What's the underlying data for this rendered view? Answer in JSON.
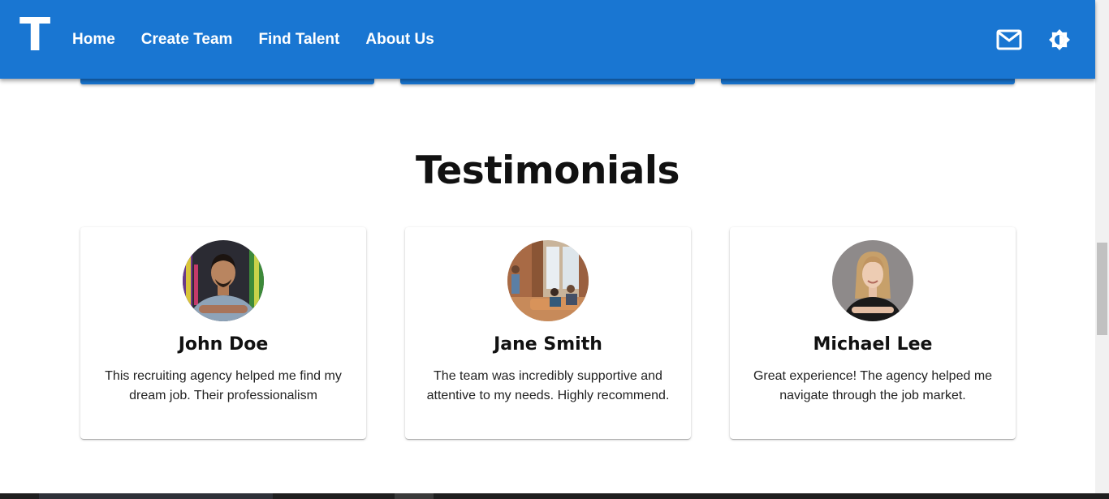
{
  "header": {
    "logo": "T",
    "nav": [
      "Home",
      "Create Team",
      "Find Talent",
      "About Us"
    ],
    "icons": [
      "mail-icon",
      "brightness-icon"
    ],
    "color": "#1976d2"
  },
  "testimonials": {
    "title": "Testimonials",
    "items": [
      {
        "name": "John Doe",
        "text": "This recruiting agency helped me find my dream job. Their professionalism",
        "avatar": "man-portrait"
      },
      {
        "name": "Jane Smith",
        "text": "The team was incredibly supportive and attentive to my needs. Highly recommend.",
        "avatar": "office-team-photo"
      },
      {
        "name": "Michael Lee",
        "text": "Great experience! The agency helped me navigate through the job market.",
        "avatar": "woman-portrait"
      }
    ]
  }
}
